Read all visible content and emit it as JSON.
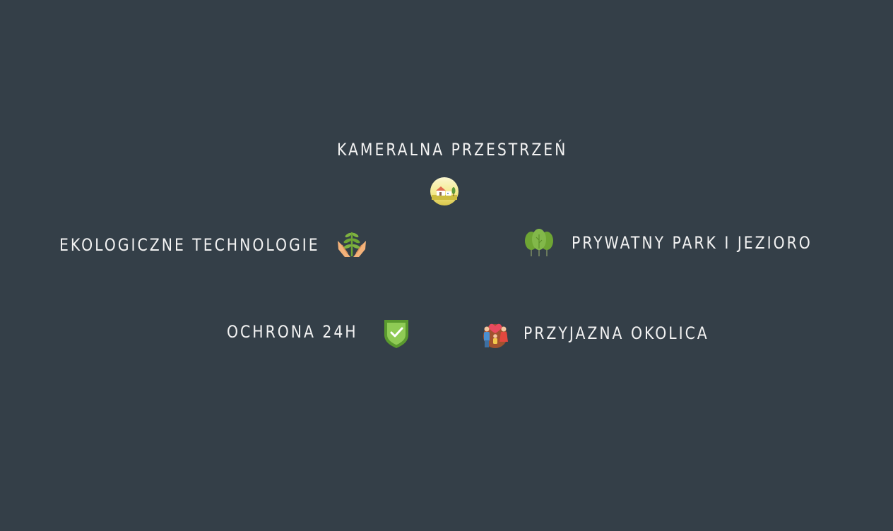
{
  "features": {
    "cozy_space": {
      "label": "KAMERALNA PRZESTRZEŃ",
      "icon": "house-landscape-icon"
    },
    "eco_tech": {
      "label": "EKOLOGICZNE TECHNOLOGIE",
      "icon": "hands-plant-icon"
    },
    "private_park": {
      "label": "PRYWATNY PARK I JEZIORO",
      "icon": "trees-icon"
    },
    "security": {
      "label": "OCHRONA 24H",
      "icon": "shield-check-icon"
    },
    "friendly_area": {
      "label": "PRZYJAZNA OKOLICA",
      "icon": "family-heart-icon"
    }
  },
  "colors": {
    "background": "#343f48",
    "text": "#f2f2f2",
    "shield_green": "#7dc143",
    "tree_green": "#6ea534",
    "hand_skin": "#f3b27a"
  }
}
